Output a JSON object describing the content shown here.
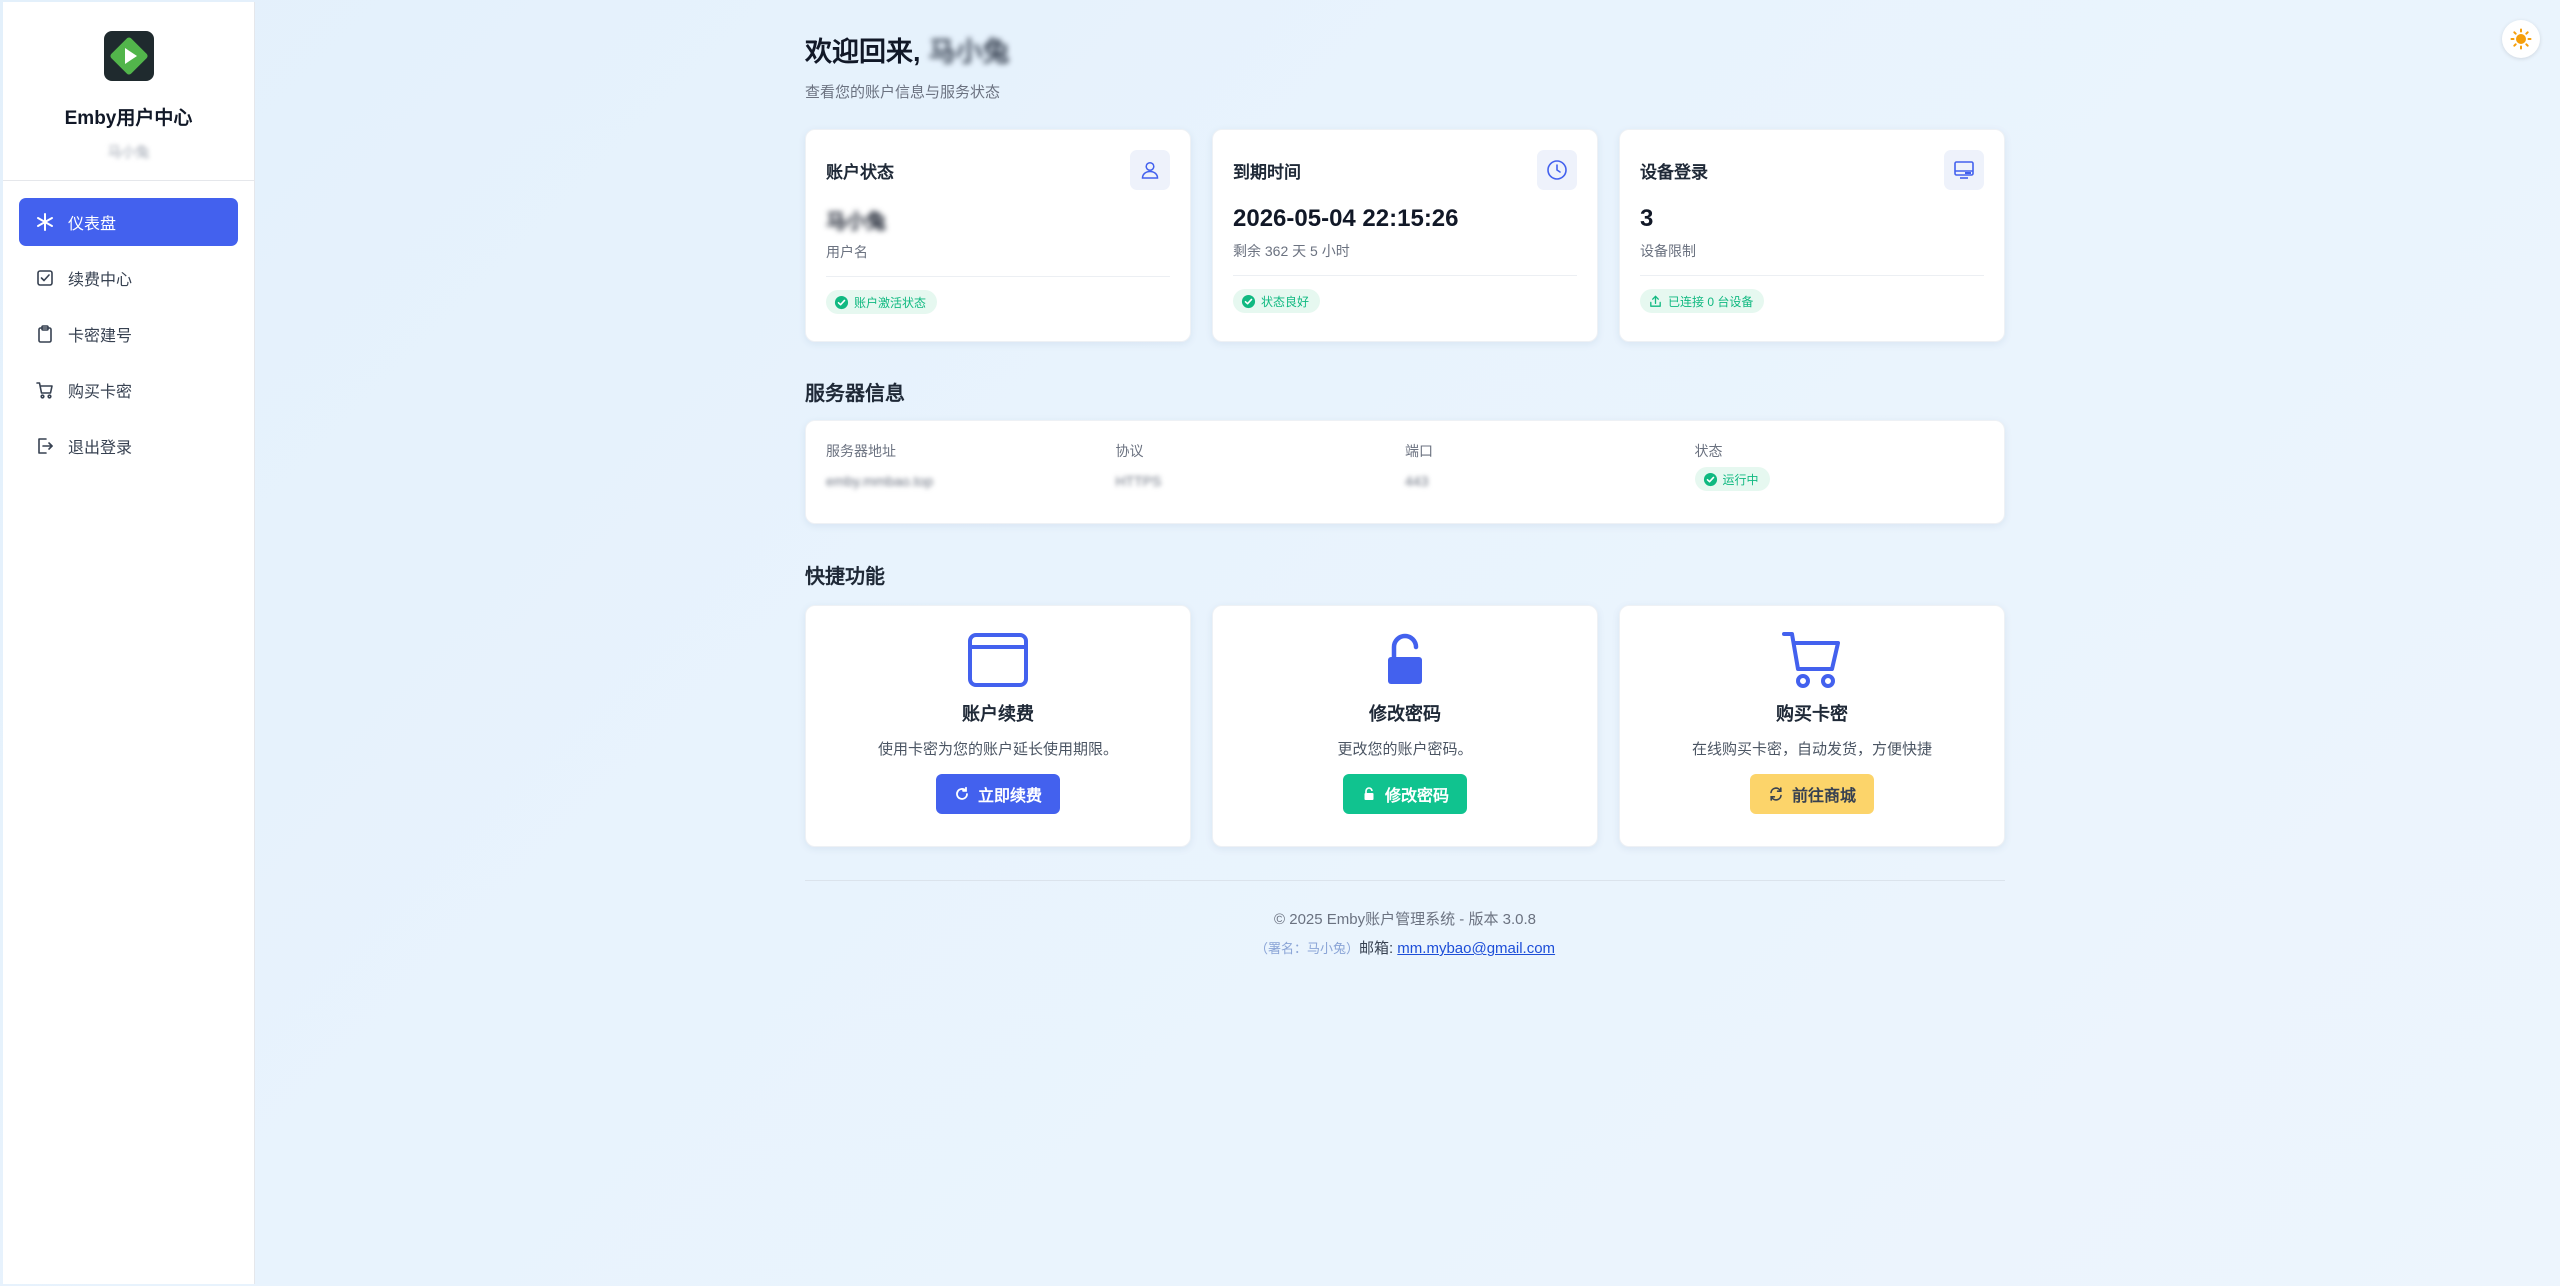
{
  "sidebar": {
    "brand_title": "Emby用户中心",
    "username": "马小兔",
    "items": [
      {
        "label": "仪表盘",
        "icon": "asterisk-icon",
        "active": true
      },
      {
        "label": "续费中心",
        "icon": "checkbox-icon"
      },
      {
        "label": "卡密建号",
        "icon": "clipboard-icon"
      },
      {
        "label": "购买卡密",
        "icon": "cart-icon"
      },
      {
        "label": "退出登录",
        "icon": "logout-icon"
      }
    ]
  },
  "header": {
    "welcome": "欢迎回来,",
    "name": "马小兔",
    "subtitle": "查看您的账户信息与服务状态"
  },
  "stats": [
    {
      "title": "账户状态",
      "value": "马小兔",
      "label": "用户名",
      "badge": "账户激活状态",
      "icon": "user-icon"
    },
    {
      "title": "到期时间",
      "value": "2026-05-04 22:15:26",
      "label": "剩余 362 天 5 小时",
      "badge": "状态良好",
      "icon": "clock-icon"
    },
    {
      "title": "设备登录",
      "value": "3",
      "label": "设备限制",
      "badge": "已连接 0 台设备",
      "icon": "monitor-icon"
    }
  ],
  "server": {
    "title": "服务器信息",
    "fields": [
      {
        "label": "服务器地址",
        "value": "emby.mmbao.top"
      },
      {
        "label": "协议",
        "value": "HTTPS"
      },
      {
        "label": "端口",
        "value": "443"
      },
      {
        "label": "状态",
        "value": "运行中"
      }
    ]
  },
  "quick": {
    "title": "快捷功能",
    "cards": [
      {
        "name": "账户续费",
        "desc": "使用卡密为您的账户延长使用期限。",
        "button": "立即续费",
        "color": "#4361ee"
      },
      {
        "name": "修改密码",
        "desc": "更改您的账户密码。",
        "button": "修改密码",
        "color": "#10c38f"
      },
      {
        "name": "购买卡密",
        "desc": "在线购买卡密，自动发货，方便快捷",
        "button": "前往商城",
        "color": "#fcd46a"
      }
    ]
  },
  "footer": {
    "copyright": "© 2025 Emby账户管理系统 - 版本 3.0.8",
    "sign": "（署名：马小兔）",
    "email_label": "邮箱:",
    "email": "mm.mybao@gmail.com"
  },
  "colors": {
    "accent": "#4361ee",
    "success": "#10b981",
    "warning": "#fcd46a"
  }
}
